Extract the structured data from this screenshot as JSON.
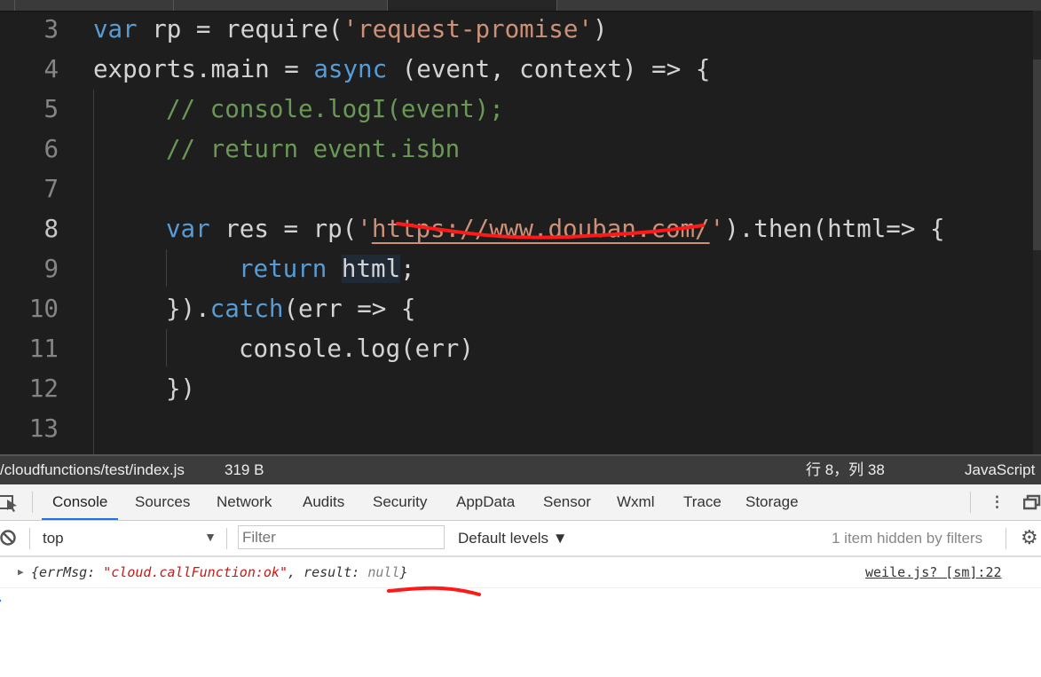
{
  "editor": {
    "current_line": 8,
    "lines": [
      {
        "n": "3",
        "indent": 0,
        "tokens": [
          [
            "kw",
            "var"
          ],
          [
            "tx",
            " rp = require("
          ],
          [
            "str",
            "'request-promise'"
          ],
          [
            "tx",
            ")"
          ]
        ]
      },
      {
        "n": "4",
        "indent": 0,
        "tokens": [
          [
            "tx",
            "exports.main = "
          ],
          [
            "kw",
            "async"
          ],
          [
            "tx",
            " (event, context) => {"
          ]
        ]
      },
      {
        "n": "5",
        "indent": 1,
        "tokens": [
          [
            "cm",
            "// console.logI(event);"
          ]
        ]
      },
      {
        "n": "6",
        "indent": 1,
        "tokens": [
          [
            "cm",
            "// return event.isbn"
          ]
        ]
      },
      {
        "n": "7",
        "indent": 1,
        "tokens": []
      },
      {
        "n": "8",
        "indent": 1,
        "tokens": [
          [
            "kw",
            "var"
          ],
          [
            "tx",
            " res = rp("
          ],
          [
            "str",
            "'"
          ],
          [
            "url",
            "https://www.douban.com/"
          ],
          [
            "str",
            "'"
          ],
          [
            "tx",
            ").then(html=> {"
          ]
        ]
      },
      {
        "n": "9",
        "indent": 2,
        "tokens": [
          [
            "kw",
            "return"
          ],
          [
            "tx",
            " "
          ],
          [
            "hl",
            "html"
          ],
          [
            "tx",
            ";"
          ]
        ]
      },
      {
        "n": "10",
        "indent": 1,
        "tokens": [
          [
            "tx",
            "})."
          ],
          [
            "kw",
            "catch"
          ],
          [
            "tx",
            "(err => {"
          ]
        ]
      },
      {
        "n": "11",
        "indent": 2,
        "tokens": [
          [
            "tx",
            "console.log(err)"
          ]
        ]
      },
      {
        "n": "12",
        "indent": 1,
        "tokens": [
          [
            "tx",
            "})"
          ]
        ]
      },
      {
        "n": "13",
        "indent": 1,
        "tokens": []
      }
    ]
  },
  "status": {
    "path": "/cloudfunctions/test/index.js",
    "size": "319 B",
    "cursor": "行 8，列 38",
    "language": "JavaScript"
  },
  "devtools": {
    "tabs": [
      "Console",
      "Sources",
      "Network",
      "Audits",
      "Security",
      "AppData",
      "Sensor",
      "Wxml",
      "Trace",
      "Storage"
    ],
    "active_tab": "Console"
  },
  "console": {
    "context": "top",
    "filter_placeholder": "Filter",
    "levels": "Default levels ▼",
    "hidden_info": "1 item hidden by filters",
    "log": {
      "open": "{errMsg: ",
      "errmsg": "\"cloud.callFunction:ok\"",
      "mid": ", result: ",
      "result": "null",
      "close": "}",
      "source": "weile.js? [sm]:22"
    }
  },
  "annotation_color": "#ff1a1a"
}
